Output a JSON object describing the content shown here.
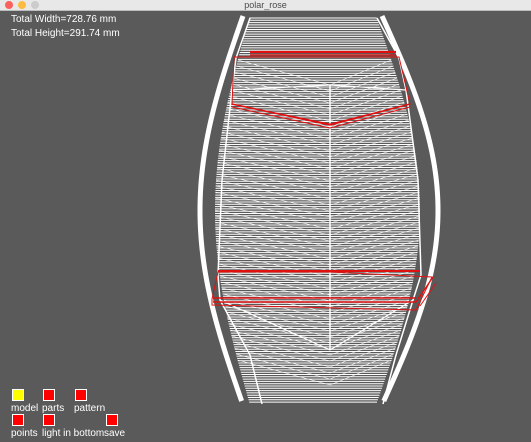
{
  "window": {
    "title": "polar_rose",
    "traffic_lights": {
      "close": "#fc605b",
      "minimize": "#fdbc40",
      "zoom": "#cccccc"
    }
  },
  "readouts": {
    "width": "Total Width=728.76 mm",
    "height": "Total Height=291.74 mm"
  },
  "colors": {
    "background": "#5a5a5a",
    "wireframe": "#ffffff",
    "highlight": "#e01010",
    "checkbox_on": "#ffff00",
    "checkbox_off": "#ff0000"
  },
  "controls": [
    {
      "id": "model",
      "label": "model",
      "state_color": "yellow"
    },
    {
      "id": "parts",
      "label": "parts",
      "state_color": "red"
    },
    {
      "id": "pattern",
      "label": "pattern",
      "state_color": "red"
    },
    {
      "id": "points",
      "label": "points",
      "state_color": "red"
    },
    {
      "id": "light_in_bottom",
      "label": "light in bottom",
      "state_color": "red"
    },
    {
      "id": "save",
      "label": "save",
      "state_color": "red"
    }
  ]
}
